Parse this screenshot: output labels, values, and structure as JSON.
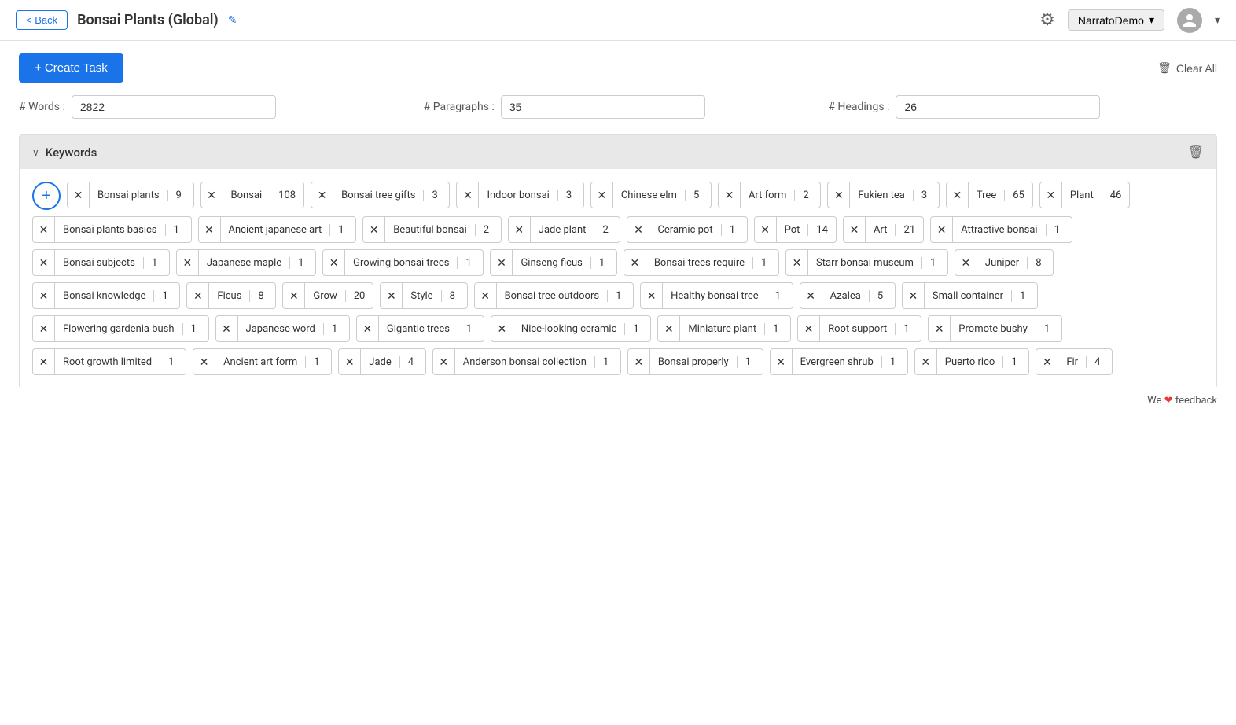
{
  "header": {
    "back_label": "< Back",
    "title": "Bonsai Plants (Global)",
    "edit_icon": "✎",
    "dropdown_label": "NarratoDemo",
    "dropdown_arrow": "▾"
  },
  "toolbar": {
    "create_task_label": "+ Create Task",
    "clear_all_label": "Clear All"
  },
  "stats": {
    "words_label": "# Words :",
    "words_value": "2822",
    "paragraphs_label": "# Paragraphs :",
    "paragraphs_value": "35",
    "headings_label": "# Headings :",
    "headings_value": "26"
  },
  "keywords_section": {
    "title": "Keywords",
    "keywords": [
      {
        "text": "Bonsai plants",
        "count": "9"
      },
      {
        "text": "Bonsai",
        "count": "108"
      },
      {
        "text": "Bonsai tree gifts",
        "count": "3"
      },
      {
        "text": "Indoor bonsai",
        "count": "3"
      },
      {
        "text": "Chinese elm",
        "count": "5"
      },
      {
        "text": "Art form",
        "count": "2"
      },
      {
        "text": "Fukien tea",
        "count": "3"
      },
      {
        "text": "Tree",
        "count": "65"
      },
      {
        "text": "Plant",
        "count": "46"
      },
      {
        "text": "Bonsai plants basics",
        "count": "1"
      },
      {
        "text": "Ancient japanese art",
        "count": "1"
      },
      {
        "text": "Beautiful bonsai",
        "count": "2"
      },
      {
        "text": "Jade plant",
        "count": "2"
      },
      {
        "text": "Ceramic pot",
        "count": "1"
      },
      {
        "text": "Pot",
        "count": "14"
      },
      {
        "text": "Art",
        "count": "21"
      },
      {
        "text": "Attractive bonsai",
        "count": "1"
      },
      {
        "text": "Bonsai subjects",
        "count": "1"
      },
      {
        "text": "Japanese maple",
        "count": "1"
      },
      {
        "text": "Growing bonsai trees",
        "count": "1"
      },
      {
        "text": "Ginseng ficus",
        "count": "1"
      },
      {
        "text": "Bonsai trees require",
        "count": "1"
      },
      {
        "text": "Starr bonsai museum",
        "count": "1"
      },
      {
        "text": "Juniper",
        "count": "8"
      },
      {
        "text": "Bonsai knowledge",
        "count": "1"
      },
      {
        "text": "Ficus",
        "count": "8"
      },
      {
        "text": "Grow",
        "count": "20"
      },
      {
        "text": "Style",
        "count": "8"
      },
      {
        "text": "Bonsai tree outdoors",
        "count": "1"
      },
      {
        "text": "Healthy bonsai tree",
        "count": "1"
      },
      {
        "text": "Azalea",
        "count": "5"
      },
      {
        "text": "Small container",
        "count": "1"
      },
      {
        "text": "Flowering gardenia bush",
        "count": "1"
      },
      {
        "text": "Japanese word",
        "count": "1"
      },
      {
        "text": "Gigantic trees",
        "count": "1"
      },
      {
        "text": "Nice-looking ceramic",
        "count": "1"
      },
      {
        "text": "Miniature plant",
        "count": "1"
      },
      {
        "text": "Root support",
        "count": "1"
      },
      {
        "text": "Promote bushy",
        "count": "1"
      },
      {
        "text": "Root growth limited",
        "count": "1"
      },
      {
        "text": "Ancient art form",
        "count": "1"
      },
      {
        "text": "Jade",
        "count": "4"
      },
      {
        "text": "Anderson bonsai collection",
        "count": "1"
      },
      {
        "text": "Bonsai properly",
        "count": "1"
      },
      {
        "text": "Evergreen shrub",
        "count": "1"
      },
      {
        "text": "Puerto rico",
        "count": "1"
      },
      {
        "text": "Fir",
        "count": "4"
      }
    ]
  },
  "feedback": {
    "text": "We",
    "heart": "❤",
    "text2": "feedback"
  }
}
